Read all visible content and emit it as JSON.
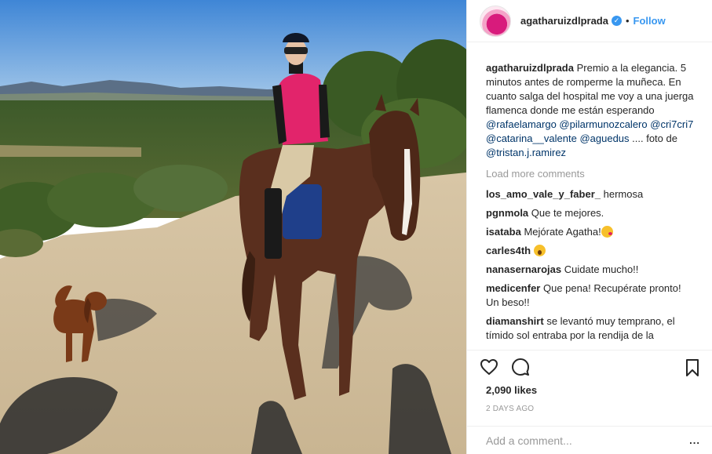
{
  "post": {
    "username": "agatharuizdlprada",
    "verified_icon": "verified-badge-icon",
    "separator": "•",
    "follow_label": "Follow",
    "avatar_icon": "avatar"
  },
  "caption": {
    "username": "agatharuizdlprada",
    "text": "Premio a la elegancia. 5 minutos antes de romperme la muñeca. En cuanto salga del hospital me voy a una juerga flamenca donde me están esperando",
    "mentions": [
      "@rafaelamargo",
      "@pilarmunozcalero",
      "@cri7cri7",
      "@catarina__valente",
      "@aguedus"
    ],
    "suffix": ".... foto de",
    "photo_credit": "@tristan.j.ramirez"
  },
  "load_more_label": "Load more comments",
  "comments": [
    {
      "user": "los_amo_vale_y_faber_",
      "text": "hermosa"
    },
    {
      "user": "pgnmola",
      "text": "Que te mejores."
    },
    {
      "user": "isataba",
      "text": "Mejórate Agatha!",
      "emoji": "kiss-emoji-icon"
    },
    {
      "user": "carles4th",
      "text": "",
      "emoji": "scream-emoji-icon"
    },
    {
      "user": "nanasernarojas",
      "text": "Cuidate mucho!!"
    },
    {
      "user": "medicenfer",
      "text": "Que pena! Recupérate pronto! Un beso!!"
    },
    {
      "user": "diamanshirt",
      "text": "se levantó muy temprano, el tímido sol entraba por la rendija de la"
    }
  ],
  "actions": {
    "like_icon": "heart-icon",
    "comment_icon": "comment-icon",
    "save_icon": "bookmark-icon"
  },
  "likes": "2,090 likes",
  "time_ago": "2 DAYS AGO",
  "add_comment": {
    "placeholder": "Add a comment...",
    "more_label": "..."
  },
  "colors": {
    "link_blue": "#3897f0",
    "mention_blue": "#003569",
    "muted_gray": "#999999",
    "border": "#efefef"
  }
}
